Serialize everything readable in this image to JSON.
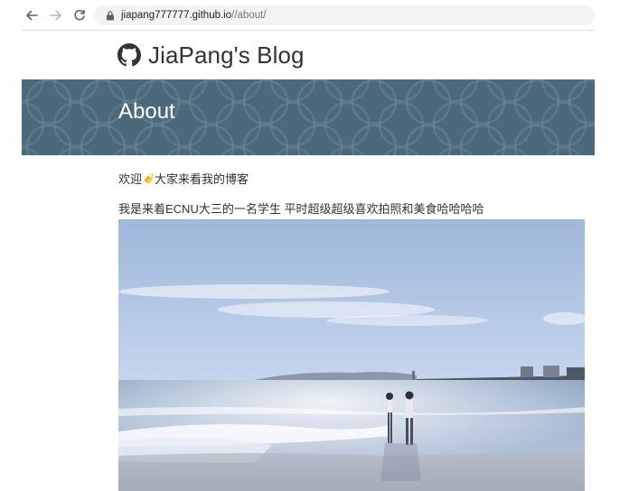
{
  "browser": {
    "back_icon": "arrow-left-icon",
    "forward_icon": "arrow-right-icon",
    "reload_icon": "reload-icon",
    "url_host": "jiapang777777.github.io",
    "url_path": "//about/"
  },
  "site": {
    "logo_icon": "github-icon",
    "title": "JiaPang's Blog"
  },
  "banner": {
    "title": "About"
  },
  "content": {
    "welcome_pre": "欢迎",
    "welcome_icon": "clapping-hands-icon",
    "welcome_post": "大家来看我的博客",
    "intro": "我是来着ECNU大三的一名学生 平时超级超级喜欢拍照和美食哈哈哈哈"
  },
  "colors": {
    "banner": "#4f6f82",
    "address_bar": "#f1f3f4"
  }
}
